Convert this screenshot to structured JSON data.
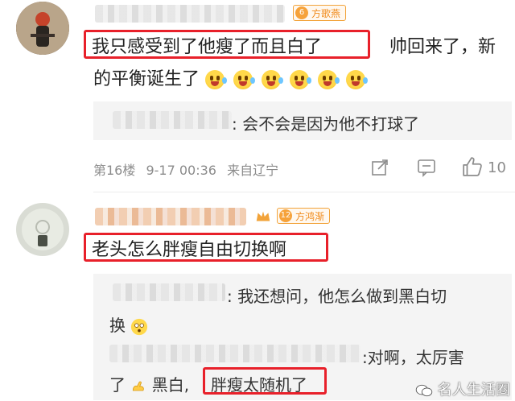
{
  "comments": [
    {
      "username": "",
      "badge": {
        "level": "6",
        "label": "方歌燕"
      },
      "text_highlight": "我只感受到了他瘦了而且白了",
      "text_rest_line1": "帅回来了，新",
      "text_line2": "的平衡诞生了",
      "emoji_name": "laughing-crying-emoji",
      "reply": {
        "username": "",
        "text": ": 会不会是因为他不打球了"
      },
      "meta": {
        "floor": "第16楼",
        "time": "9-17 00:36",
        "location": "来自辽宁"
      },
      "like_count": "10"
    },
    {
      "username": "",
      "badge": {
        "level": "12",
        "label": "方鸿渐"
      },
      "text_highlight": "老头怎么胖瘦自由切换啊",
      "replies": [
        {
          "username": "",
          "line1": ": 我还想问，他怎么做到黑白切",
          "line2": "换"
        },
        {
          "username": "",
          "line1": ":对啊，太厉害",
          "line2_a": "了",
          "line2_b": "黑白,",
          "line2_highlight": "胖瘦太随机了"
        }
      ]
    }
  ],
  "watermark": "名人生活圈",
  "colors": {
    "highlight_border": "#e8202a",
    "badge": "#f08a1a",
    "meta_gray": "#8c8c8c"
  }
}
